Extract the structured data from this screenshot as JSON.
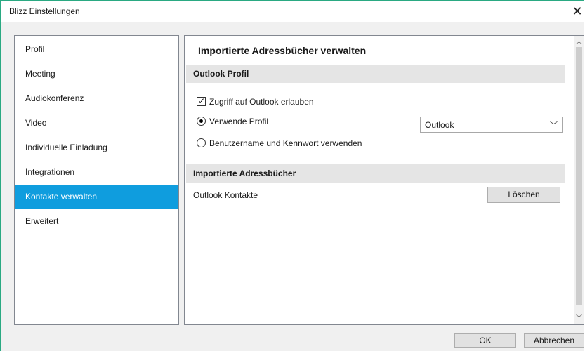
{
  "window": {
    "title": "Blizz Einstellungen",
    "close_glyph": "✕"
  },
  "sidebar": {
    "items": [
      {
        "label": "Profil"
      },
      {
        "label": "Meeting"
      },
      {
        "label": "Audiokonferenz"
      },
      {
        "label": "Video"
      },
      {
        "label": "Individuelle Einladung"
      },
      {
        "label": "Integrationen"
      },
      {
        "label": "Kontakte verwalten",
        "active": true
      },
      {
        "label": "Erweitert"
      }
    ]
  },
  "main": {
    "title": "Importierte Adressbücher verwalten",
    "outlook_section": {
      "header": "Outlook Profil",
      "allow_access_label": "Zugriff auf Outlook erlauben",
      "allow_access_checked": true,
      "use_profile_label": "Verwende Profil",
      "use_profile_selected": true,
      "profile_value": "Outlook",
      "credentials_label": "Benutzername und Kennwort verwenden",
      "credentials_selected": false
    },
    "address_books_section": {
      "header": "Importierte Adressbücher",
      "items": [
        {
          "name": "Outlook Kontakte",
          "action_label": "Löschen"
        }
      ]
    }
  },
  "footer": {
    "ok_label": "OK",
    "cancel_label": "Abbrechen"
  },
  "colors": {
    "accent": "#0f9dde",
    "window_border": "#2aa982"
  }
}
